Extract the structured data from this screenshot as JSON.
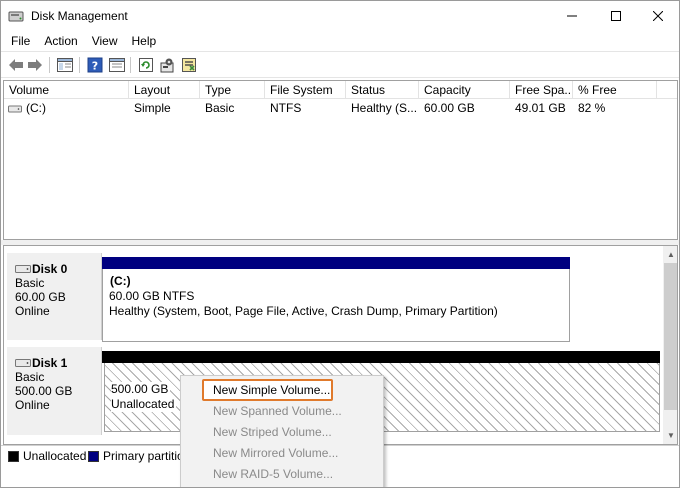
{
  "window": {
    "title": "Disk Management"
  },
  "menu": [
    "File",
    "Action",
    "View",
    "Help"
  ],
  "toolbar": {
    "icons": [
      "back-arrow-icon",
      "forward-arrow-icon",
      "console-tree-icon",
      "help-icon",
      "properties-icon",
      "refresh-icon",
      "settings-icon",
      "rescan-disks-icon"
    ]
  },
  "volume_list": {
    "columns": [
      "Volume",
      "Layout",
      "Type",
      "File System",
      "Status",
      "Capacity",
      "Free Spa...",
      "% Free"
    ],
    "rows": [
      {
        "volume": "(C:)",
        "layout": "Simple",
        "type": "Basic",
        "file_system": "NTFS",
        "status": "Healthy (S...",
        "capacity": "60.00 GB",
        "free_space": "49.01 GB",
        "pct_free": "82 %"
      }
    ]
  },
  "disks": [
    {
      "name": "Disk 0",
      "type": "Basic",
      "size": "60.00 GB",
      "state": "Online",
      "partition": {
        "name": "(C:)",
        "size": "60.00 GB NTFS",
        "status": "Healthy (System, Boot, Page File, Active, Crash Dump, Primary Partition)"
      }
    },
    {
      "name": "Disk 1",
      "type": "Basic",
      "size": "500.00 GB",
      "state": "Online",
      "partition": {
        "size": "500.00 GB",
        "status": "Unallocated"
      }
    }
  ],
  "legend": [
    {
      "label": "Unallocated",
      "color": "#000000"
    },
    {
      "label": "Primary partitio",
      "color": "#000080"
    }
  ],
  "context_menu": {
    "items": [
      {
        "label": "New Simple Volume...",
        "enabled": true
      },
      {
        "label": "New Spanned Volume...",
        "enabled": false
      },
      {
        "label": "New Striped Volume...",
        "enabled": false
      },
      {
        "label": "New Mirrored Volume...",
        "enabled": false
      },
      {
        "label": "New RAID-5 Volume...",
        "enabled": false
      }
    ],
    "highlight_color": "#e07a2c"
  },
  "colors": {
    "primary_partition": "#000080",
    "unallocated": "#000000"
  }
}
